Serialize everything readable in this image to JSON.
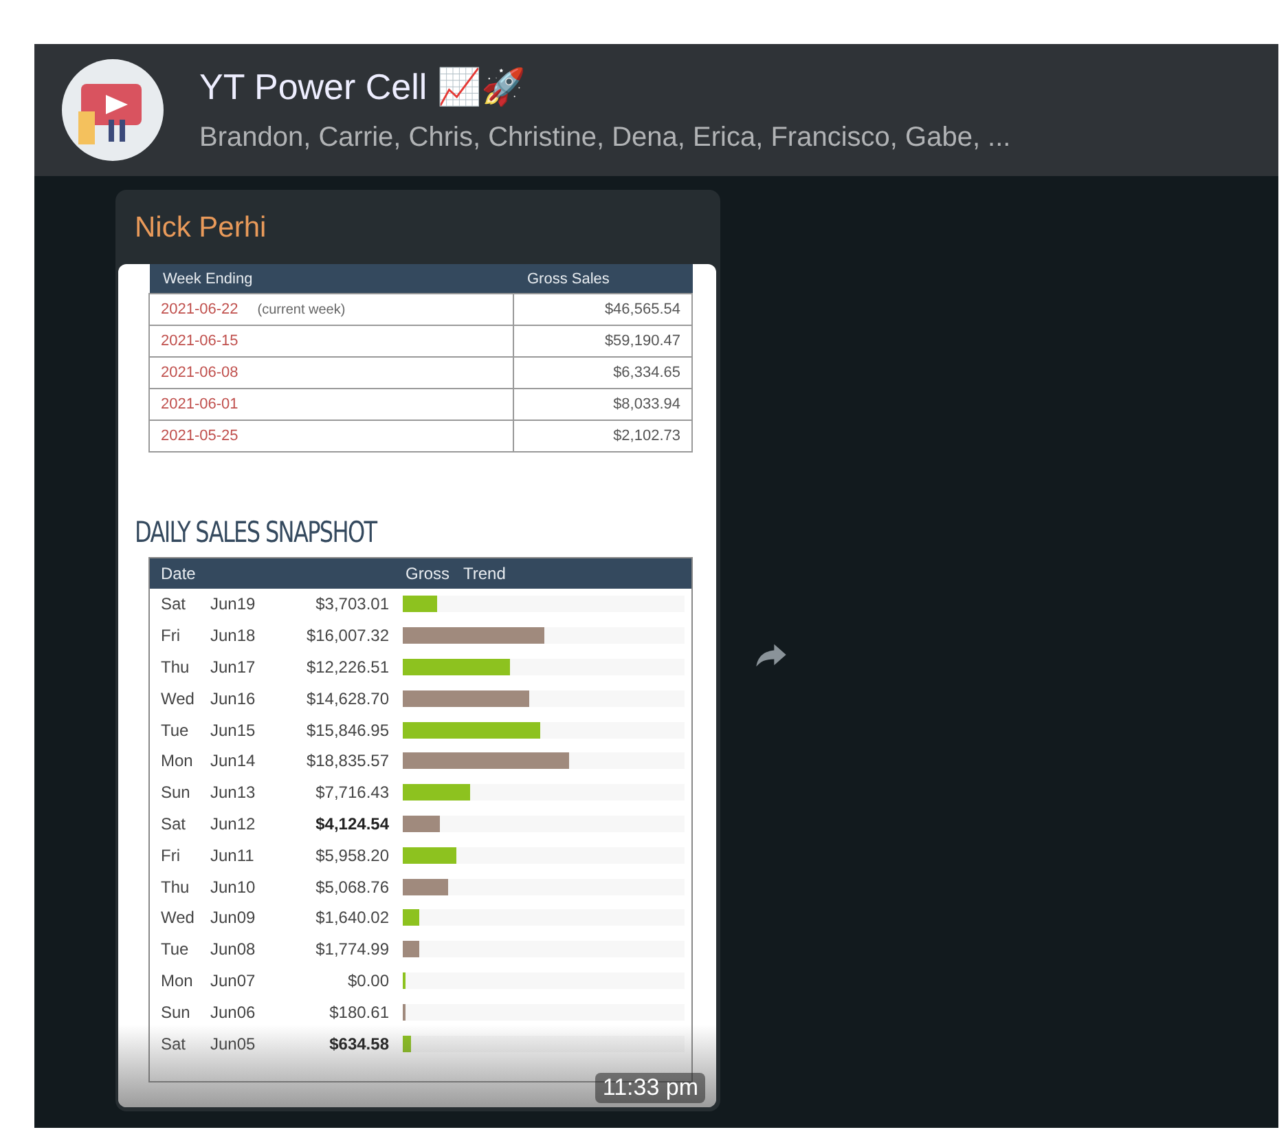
{
  "chat": {
    "title": "YT Power Cell 📈🚀",
    "members": "Brandon, Carrie, Chris, Christine, Dena, Erica, Francisco, Gabe, ..."
  },
  "message": {
    "sender": "Nick Perhi",
    "time": "11:33 pm",
    "weekly": {
      "columns": [
        "Week Ending",
        "Gross Sales"
      ],
      "rows": [
        {
          "week": "2021-06-22",
          "note": "(current week)",
          "gross": "$46,565.54"
        },
        {
          "week": "2021-06-15",
          "gross": "$59,190.47"
        },
        {
          "week": "2021-06-08",
          "gross": "$6,334.65"
        },
        {
          "week": "2021-06-01",
          "gross": "$8,033.94"
        },
        {
          "week": "2021-05-25",
          "gross": "$2,102.73"
        }
      ]
    },
    "daily": {
      "title": "DAILY SALES SNAPSHOT",
      "columns": [
        "Date",
        "Gross",
        "Trend"
      ],
      "rows": [
        {
          "day": "Sat",
          "date": "Jun19",
          "gross": "$3,703.01",
          "bold": false,
          "level": 0.12,
          "color": "#8dc21f"
        },
        {
          "day": "Fri",
          "date": "Jun18",
          "gross": "$16,007.32",
          "bold": false,
          "level": 0.5,
          "color": "#a08a7d"
        },
        {
          "day": "Thu",
          "date": "Jun17",
          "gross": "$12,226.51",
          "bold": false,
          "level": 0.38,
          "color": "#8dc21f"
        },
        {
          "day": "Wed",
          "date": "Jun16",
          "gross": "$14,628.70",
          "bold": false,
          "level": 0.45,
          "color": "#a08a7d"
        },
        {
          "day": "Tue",
          "date": "Jun15",
          "gross": "$15,846.95",
          "bold": false,
          "level": 0.49,
          "color": "#8dc21f"
        },
        {
          "day": "Mon",
          "date": "Jun14",
          "gross": "$18,835.57",
          "bold": false,
          "level": 0.59,
          "color": "#a08a7d"
        },
        {
          "day": "Sun",
          "date": "Jun13",
          "gross": "$7,716.43",
          "bold": false,
          "level": 0.24,
          "color": "#8dc21f"
        },
        {
          "day": "Sat",
          "date": "Jun12",
          "gross": "$4,124.54",
          "bold": true,
          "level": 0.13,
          "color": "#a08a7d"
        },
        {
          "day": "Fri",
          "date": "Jun11",
          "gross": "$5,958.20",
          "bold": false,
          "level": 0.19,
          "color": "#8dc21f"
        },
        {
          "day": "Thu",
          "date": "Jun10",
          "gross": "$5,068.76",
          "bold": false,
          "level": 0.16,
          "color": "#a08a7d"
        },
        {
          "day": "Wed",
          "date": "Jun09",
          "gross": "$1,640.02",
          "bold": false,
          "level": 0.06,
          "color": "#8dc21f"
        },
        {
          "day": "Tue",
          "date": "Jun08",
          "gross": "$1,774.99",
          "bold": false,
          "level": 0.06,
          "color": "#a08a7d"
        },
        {
          "day": "Mon",
          "date": "Jun07",
          "gross": "$0.00",
          "bold": false,
          "level": 0.01,
          "color": "#8dc21f"
        },
        {
          "day": "Sun",
          "date": "Jun06",
          "gross": "$180.61",
          "bold": false,
          "level": 0.01,
          "color": "#a08a7d"
        },
        {
          "day": "Sat",
          "date": "Jun05",
          "gross": "$634.58",
          "bold": true,
          "level": 0.03,
          "color": "#8dc21f"
        }
      ]
    }
  }
}
